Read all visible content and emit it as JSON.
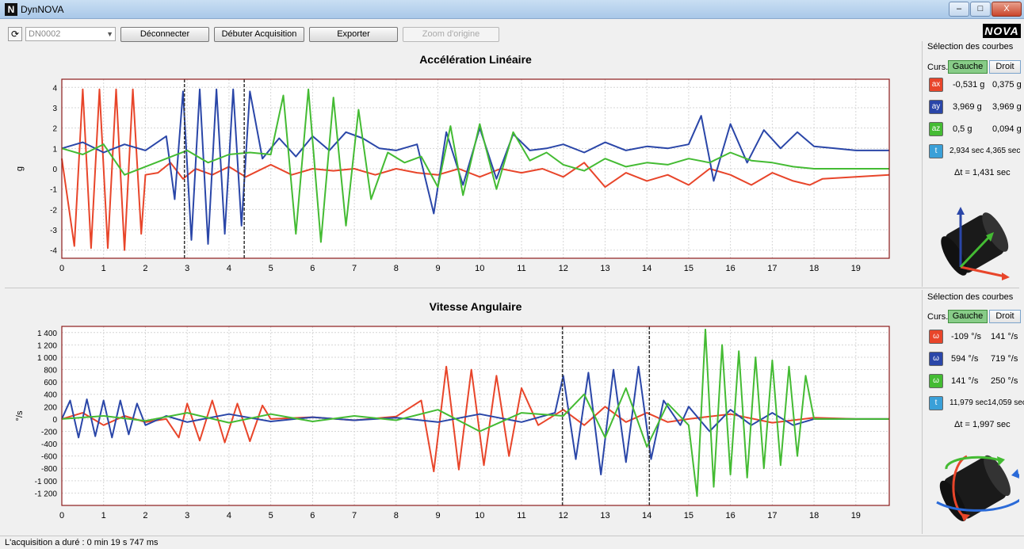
{
  "window": {
    "title": "DynNOVA",
    "icon_letter": "N",
    "minimize": "–",
    "maximize": "□",
    "close": "X"
  },
  "toolbar": {
    "device_value": "DN0002",
    "disconnect": "Déconnecter",
    "start_acq": "Débuter Acquisition",
    "export": "Exporter",
    "zoom_origin": "Zoom d'origine",
    "logo": "NOVA"
  },
  "colors": {
    "ax": "#e8452a",
    "ay": "#2a46a8",
    "az": "#44bb33",
    "t": "#3aa0d8",
    "plot_border": "#8b1a1a"
  },
  "panels": [
    {
      "section_title": "Sélection des courbes",
      "curs_label": "Curs.",
      "left_label": "Gauche",
      "right_label": "Droit",
      "rows": [
        {
          "icon": "ax",
          "left": "-0,531 g",
          "right": "0,375 g"
        },
        {
          "icon": "ay",
          "left": "3,969 g",
          "right": "3,969 g"
        },
        {
          "icon": "az",
          "left": "0,5 g",
          "right": "0,094 g"
        },
        {
          "icon": "t",
          "left": "2,934 sec",
          "right": "4,365 sec"
        }
      ],
      "delta": "Δt = 1,431 sec"
    },
    {
      "section_title": "Sélection des courbes",
      "curs_label": "Curs.",
      "left_label": "Gauche",
      "right_label": "Droit",
      "rows": [
        {
          "icon": "ω",
          "left": "-109 °/s",
          "right": "141 °/s"
        },
        {
          "icon": "ω",
          "left": "594 °/s",
          "right": "719 °/s"
        },
        {
          "icon": "ω",
          "left": "141 °/s",
          "right": "250 °/s"
        },
        {
          "icon": "t",
          "left": "11,979 sec",
          "right": "14,059 sec"
        }
      ],
      "delta": "Δt = 1,997 sec"
    }
  ],
  "chart_data": [
    {
      "type": "line",
      "title": "Accélération Linéaire",
      "ylabel": "g",
      "xlim": [
        0,
        19.8
      ],
      "ylim": [
        -4.4,
        4.4
      ],
      "xticks": [
        0,
        1,
        2,
        3,
        4,
        5,
        6,
        7,
        8,
        9,
        10,
        11,
        12,
        13,
        14,
        15,
        16,
        17,
        18,
        19
      ],
      "yticks": [
        -4,
        -3,
        -2,
        -1,
        0,
        1,
        2,
        3,
        4
      ],
      "ytick_labels": [
        "-4",
        "-3",
        "-2",
        "-1",
        "0",
        "1",
        "2",
        "3",
        "4"
      ],
      "grid": true,
      "cursors": [
        2.934,
        4.365
      ],
      "series": [
        {
          "color_key": "ax",
          "x": [
            0,
            0.3,
            0.5,
            0.7,
            0.9,
            1.1,
            1.3,
            1.5,
            1.7,
            1.9,
            2.0,
            2.3,
            2.6,
            2.9,
            3.2,
            3.6,
            4.0,
            4.4,
            5.0,
            5.5,
            6.0,
            6.5,
            7.0,
            7.5,
            8.0,
            8.5,
            9.0,
            9.5,
            10.0,
            10.5,
            11.0,
            11.5,
            12.0,
            12.5,
            13.0,
            13.5,
            14.0,
            14.5,
            15.0,
            15.5,
            16.0,
            16.5,
            17.0,
            17.5,
            17.9,
            18.2,
            19.0,
            19.8
          ],
          "y": [
            0.5,
            -3.8,
            3.9,
            -3.9,
            3.9,
            -3.9,
            3.9,
            -4.0,
            3.9,
            -3.2,
            -0.3,
            -0.2,
            0.3,
            -0.5,
            0.0,
            -0.3,
            0.1,
            -0.4,
            0.2,
            -0.3,
            0.0,
            -0.1,
            0.0,
            -0.3,
            0.0,
            -0.2,
            -0.3,
            0.0,
            -0.4,
            0.0,
            -0.2,
            0.0,
            -0.4,
            0.3,
            -0.9,
            -0.2,
            -0.6,
            -0.3,
            -0.8,
            0.0,
            -0.3,
            -0.8,
            -0.2,
            -0.6,
            -0.8,
            -0.5,
            -0.4,
            -0.3
          ]
        },
        {
          "color_key": "ay",
          "x": [
            0,
            0.5,
            1.0,
            1.5,
            2.0,
            2.5,
            2.7,
            2.9,
            3.1,
            3.3,
            3.5,
            3.7,
            3.9,
            4.1,
            4.3,
            4.5,
            4.8,
            5.2,
            5.6,
            6.0,
            6.4,
            6.8,
            7.2,
            7.6,
            8.0,
            8.5,
            8.9,
            9.2,
            9.6,
            10.0,
            10.4,
            10.8,
            11.2,
            11.6,
            12.0,
            12.5,
            13.0,
            13.5,
            14.0,
            14.5,
            15.0,
            15.3,
            15.6,
            16.0,
            16.4,
            16.8,
            17.2,
            17.6,
            18.0,
            18.5,
            19.0,
            19.8
          ],
          "y": [
            1.0,
            1.3,
            0.8,
            1.2,
            0.9,
            1.6,
            -1.5,
            3.8,
            -3.5,
            3.9,
            -3.7,
            3.9,
            -3.2,
            3.9,
            -2.8,
            3.8,
            0.5,
            1.5,
            0.6,
            1.6,
            0.9,
            1.8,
            1.5,
            1.0,
            0.9,
            1.2,
            -2.2,
            1.8,
            -0.8,
            2.0,
            -0.5,
            1.7,
            0.9,
            1.0,
            1.2,
            0.8,
            1.3,
            0.9,
            1.1,
            1.0,
            1.2,
            2.6,
            -0.6,
            2.2,
            0.3,
            1.9,
            1.0,
            1.8,
            1.1,
            1.0,
            0.9,
            0.9
          ]
        },
        {
          "color_key": "az",
          "x": [
            0,
            0.5,
            1.0,
            1.5,
            2.0,
            2.5,
            3.0,
            3.5,
            4.0,
            4.5,
            5.0,
            5.3,
            5.6,
            5.9,
            6.2,
            6.5,
            6.8,
            7.1,
            7.4,
            7.8,
            8.2,
            8.6,
            9.0,
            9.3,
            9.6,
            10.0,
            10.4,
            10.8,
            11.2,
            11.6,
            12.0,
            12.5,
            13.0,
            13.5,
            14.0,
            14.5,
            15.0,
            15.5,
            16.0,
            16.5,
            17.0,
            17.5,
            18.0,
            18.5,
            19.0,
            19.8
          ],
          "y": [
            1.0,
            0.7,
            1.2,
            -0.3,
            0.1,
            0.5,
            0.9,
            0.3,
            0.7,
            0.8,
            0.7,
            3.6,
            -3.2,
            3.9,
            -3.6,
            3.5,
            -2.8,
            2.9,
            -1.5,
            0.8,
            0.3,
            0.6,
            -0.9,
            2.1,
            -1.3,
            2.2,
            -1.0,
            1.8,
            0.4,
            0.8,
            0.2,
            -0.1,
            0.5,
            0.1,
            0.3,
            0.2,
            0.5,
            0.3,
            0.8,
            0.4,
            0.3,
            0.1,
            0.0,
            0.0,
            0.0,
            0.0
          ]
        }
      ]
    },
    {
      "type": "line",
      "title": "Vitesse Angulaire",
      "ylabel": "°/s",
      "xlim": [
        0,
        19.8
      ],
      "ylim": [
        -1400,
        1500
      ],
      "xticks": [
        0,
        1,
        2,
        3,
        4,
        5,
        6,
        7,
        8,
        9,
        10,
        11,
        12,
        13,
        14,
        15,
        16,
        17,
        18,
        19
      ],
      "yticks": [
        -1200,
        -1000,
        -800,
        -600,
        -400,
        -200,
        0,
        200,
        400,
        600,
        800,
        1000,
        1200,
        1400
      ],
      "ytick_labels": [
        "-1 200",
        "-1 000",
        "-800",
        "-600",
        "-400",
        "-200",
        "0",
        "200",
        "400",
        "600",
        "800",
        "1 000",
        "1 200",
        "1 400"
      ],
      "grid": true,
      "cursors": [
        11.979,
        14.059
      ],
      "series": [
        {
          "color_key": "ax",
          "x": [
            0,
            0.5,
            1.0,
            1.5,
            2.0,
            2.5,
            2.8,
            3.0,
            3.3,
            3.6,
            3.9,
            4.2,
            4.5,
            4.8,
            5.0,
            6.0,
            7.0,
            8.0,
            8.6,
            8.9,
            9.2,
            9.5,
            9.8,
            10.1,
            10.4,
            10.7,
            11.0,
            11.4,
            12.0,
            12.5,
            13.0,
            13.5,
            14.0,
            14.5,
            15.0,
            16.0,
            17.0,
            18.0,
            19.0,
            19.8
          ],
          "y": [
            0,
            100,
            -100,
            50,
            -50,
            0,
            -300,
            250,
            -350,
            300,
            -380,
            250,
            -360,
            220,
            0,
            30,
            -20,
            40,
            300,
            -850,
            850,
            -820,
            800,
            -750,
            700,
            -600,
            500,
            -100,
            150,
            -100,
            200,
            -50,
            100,
            -50,
            0,
            80,
            -60,
            20,
            0,
            0
          ]
        },
        {
          "color_key": "ay",
          "x": [
            0,
            0.2,
            0.4,
            0.6,
            0.8,
            1.0,
            1.2,
            1.4,
            1.6,
            1.8,
            2.0,
            2.5,
            3.0,
            4.0,
            5.0,
            6.0,
            7.0,
            8.0,
            9.0,
            10.0,
            11.0,
            11.8,
            12.0,
            12.3,
            12.6,
            12.9,
            13.2,
            13.5,
            13.8,
            14.1,
            14.4,
            14.8,
            15.0,
            15.5,
            16.0,
            16.5,
            17.0,
            17.5,
            18.0,
            19.0,
            19.8
          ],
          "y": [
            0,
            300,
            -300,
            320,
            -280,
            300,
            -300,
            300,
            -250,
            250,
            -100,
            50,
            -50,
            80,
            -40,
            30,
            -20,
            20,
            -50,
            80,
            -50,
            100,
            700,
            -650,
            750,
            -900,
            800,
            -700,
            850,
            -650,
            300,
            -100,
            200,
            -200,
            150,
            -100,
            100,
            -100,
            0,
            0,
            0
          ]
        },
        {
          "color_key": "az",
          "x": [
            0,
            1.0,
            2.0,
            3.0,
            4.0,
            5.0,
            6.0,
            7.0,
            8.0,
            9.0,
            10.0,
            11.0,
            12.0,
            12.5,
            13.0,
            13.5,
            14.0,
            14.5,
            15.0,
            15.2,
            15.4,
            15.6,
            15.8,
            16.0,
            16.2,
            16.4,
            16.6,
            16.8,
            17.0,
            17.2,
            17.4,
            17.6,
            17.8,
            18.0,
            19.0,
            19.8
          ],
          "y": [
            0,
            50,
            -30,
            100,
            -60,
            80,
            -40,
            50,
            -20,
            150,
            -200,
            100,
            50,
            400,
            -300,
            500,
            -450,
            250,
            -100,
            -1250,
            1450,
            -1100,
            1200,
            -900,
            1100,
            -950,
            1000,
            -800,
            950,
            -750,
            850,
            -600,
            700,
            0,
            0,
            0
          ]
        }
      ]
    }
  ],
  "status": {
    "text": "L'acquisition a duré : 0 min 19 s 747 ms"
  }
}
